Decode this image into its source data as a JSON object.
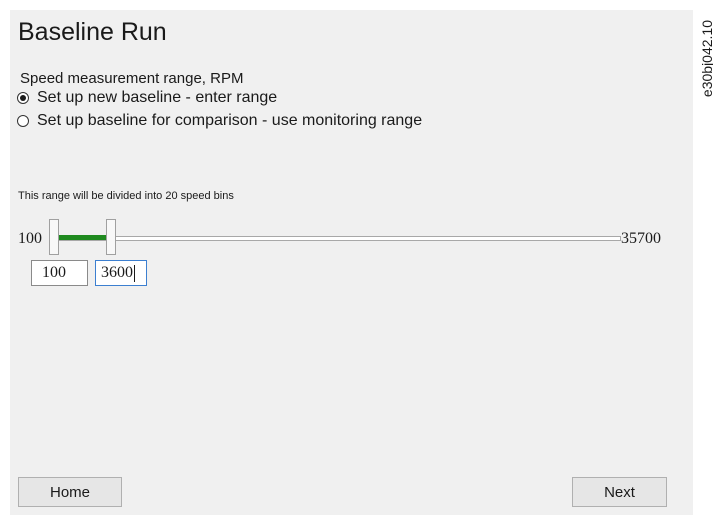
{
  "header": {
    "title": "Baseline Run"
  },
  "range": {
    "label": "Speed measurement range, RPM",
    "options": [
      {
        "label": "Set up new baseline - enter range",
        "checked": true
      },
      {
        "label": "Set up baseline for comparison - use monitoring range",
        "checked": false
      }
    ],
    "note": "This range will be divided into 20 speed bins"
  },
  "slider": {
    "min_label": "100",
    "max_label": "35700",
    "min": 100,
    "max": 35700,
    "low_value": 100,
    "high_value": 3600,
    "fill_color": "#1f8a1f"
  },
  "inputs": {
    "low": "100",
    "high": "3600"
  },
  "footer": {
    "home_label": "Home",
    "next_label": "Next"
  },
  "figure_code": "e30bj042.10"
}
